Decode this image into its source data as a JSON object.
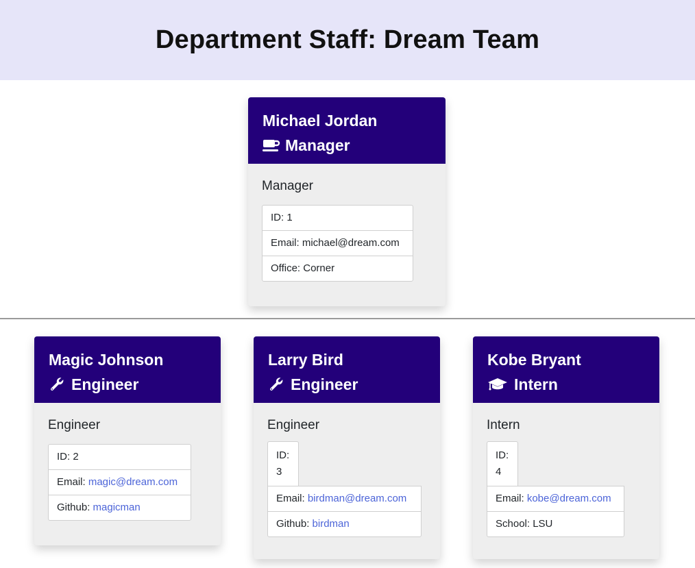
{
  "header": {
    "title": "Department Staff: Dream Team"
  },
  "manager": {
    "name": "Michael Jordan",
    "role": "Manager",
    "subtitle": "Manager",
    "icon": "coffee-icon",
    "id_text": "ID: 1",
    "email_text": "Email: michael@dream.com",
    "office_text": "Office: Corner"
  },
  "engineer1": {
    "name": "Magic Johnson",
    "role": "Engineer",
    "subtitle": "Engineer",
    "icon": "wrench-icon",
    "id_text": "ID: 2",
    "email_prefix": "Email: ",
    "email": "magic@dream.com",
    "github_prefix": "Github: ",
    "github": "magicman"
  },
  "engineer2": {
    "name": "Larry Bird",
    "role": "Engineer",
    "subtitle": "Engineer",
    "icon": "wrench-icon",
    "id_label": "ID:",
    "id_value": "3",
    "email_prefix": "Email: ",
    "email": "birdman@dream.com",
    "github_prefix": "Github: ",
    "github": "birdman"
  },
  "intern": {
    "name": "Kobe Bryant",
    "role": "Intern",
    "subtitle": "Intern",
    "icon": "graduation-cap-icon",
    "id_label": "ID:",
    "id_value": "4",
    "email_prefix": "Email: ",
    "email": "kobe@dream.com",
    "school_text": "School: LSU"
  },
  "colors": {
    "header_bg": "#e6e5f9",
    "card_head": "#23007a",
    "link": "#4c64d8",
    "card_bg": "#eeeeee"
  }
}
